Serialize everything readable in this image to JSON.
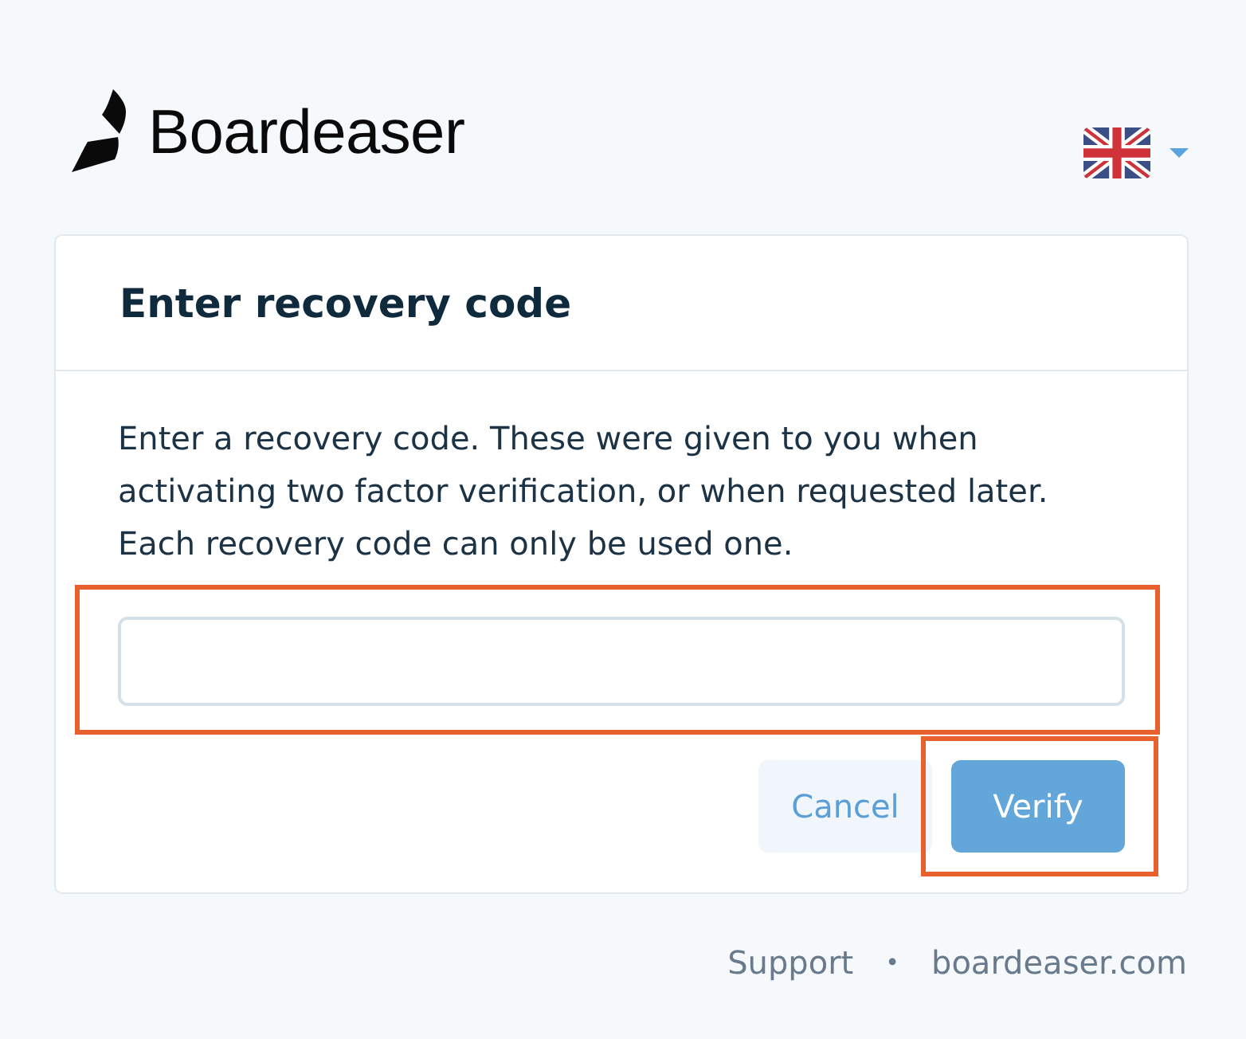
{
  "brand": {
    "name": "Boardeaser"
  },
  "dialog": {
    "title": "Enter recovery code",
    "description": "Enter a recovery code. These were given to you when activating two factor verification, or when requested later. Each recovery code can only be used one.",
    "field": {
      "highlighted": true
    },
    "buttons": [
      {
        "label": "Cancel",
        "kind": "secondary",
        "highlighted": false
      },
      {
        "label": "Verify",
        "kind": "primary",
        "highlighted": true
      }
    ]
  },
  "footer": {
    "links": [
      {
        "label": "Support"
      },
      {
        "label": "boardeaser.com"
      }
    ],
    "separator": "•"
  }
}
